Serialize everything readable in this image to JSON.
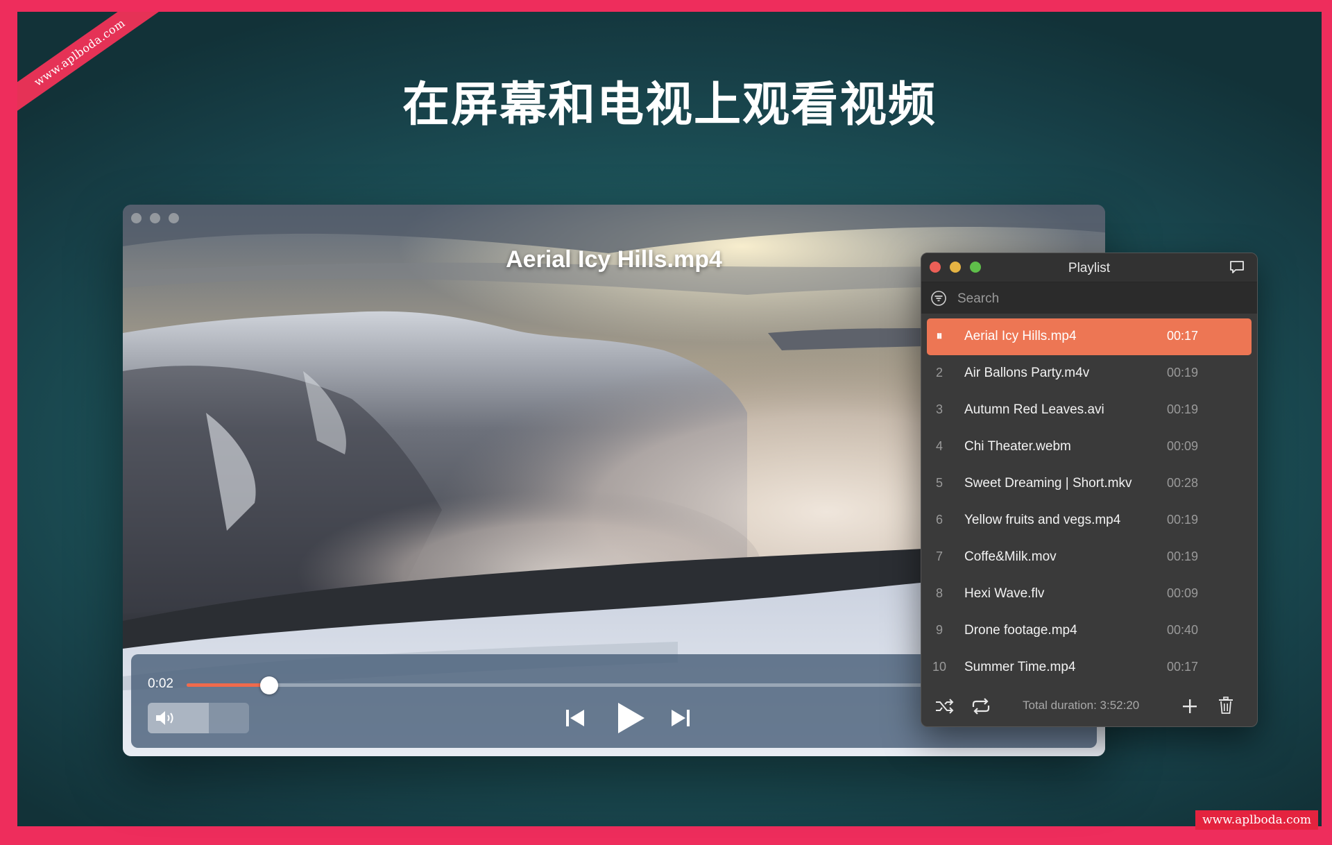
{
  "watermark_ribbon": "www.aplboda.com",
  "watermark_stamp": "www.aplboda.com",
  "headline": "在屏幕和电视上观看视频",
  "player": {
    "video_title": "Aerial Icy Hills.mp4",
    "current_time": "0:02",
    "progress_fraction": 0.11,
    "volume_fraction": 0.6,
    "accent_color": "#f06a4c"
  },
  "playlist": {
    "title": "Playlist",
    "search_placeholder": "Search",
    "items": [
      {
        "num": "⏸",
        "name": "Aerial Icy Hills.mp4",
        "duration": "00:17",
        "active": true
      },
      {
        "num": "2",
        "name": "Air Ballons Party.m4v",
        "duration": "00:19"
      },
      {
        "num": "3",
        "name": "Autumn Red Leaves.avi",
        "duration": "00:19"
      },
      {
        "num": "4",
        "name": "Chi Theater.webm",
        "duration": "00:09"
      },
      {
        "num": "5",
        "name": "Sweet Dreaming | Short.mkv",
        "duration": "00:28"
      },
      {
        "num": "6",
        "name": "Yellow fruits and vegs.mp4",
        "duration": "00:19"
      },
      {
        "num": "7",
        "name": "Coffe&Milk.mov",
        "duration": "00:19"
      },
      {
        "num": "8",
        "name": "Hexi Wave.flv",
        "duration": "00:09"
      },
      {
        "num": "9",
        "name": "Drone footage.mp4",
        "duration": "00:40"
      },
      {
        "num": "10",
        "name": "Summer Time.mp4",
        "duration": "00:17"
      }
    ],
    "total_duration": "Total duration: 3:52:20",
    "active_color": "#ed7654"
  },
  "icons": [
    "shuffle-icon",
    "repeat-icon",
    "add-icon",
    "trash-icon",
    "volume-icon",
    "previous-icon",
    "play-icon",
    "next-icon",
    "pip-icon",
    "airplay-icon",
    "settings-icon",
    "playlist-icon",
    "filter-icon",
    "comment-icon"
  ]
}
